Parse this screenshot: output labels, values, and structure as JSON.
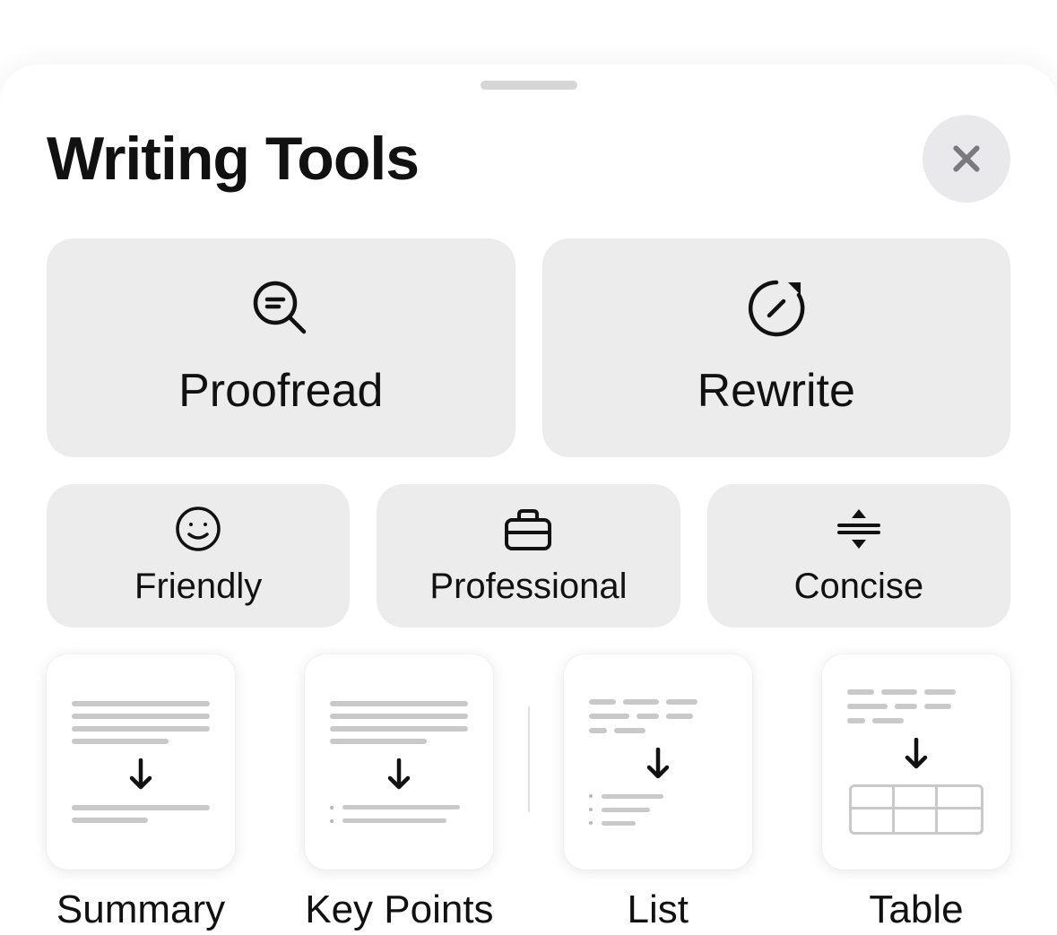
{
  "header": {
    "title": "Writing Tools"
  },
  "actions": {
    "proofread": "Proofread",
    "rewrite": "Rewrite"
  },
  "tones": {
    "friendly": "Friendly",
    "professional": "Professional",
    "concise": "Concise"
  },
  "transforms": {
    "summary": "Summary",
    "keypoints": "Key Points",
    "list": "List",
    "table": "Table"
  }
}
